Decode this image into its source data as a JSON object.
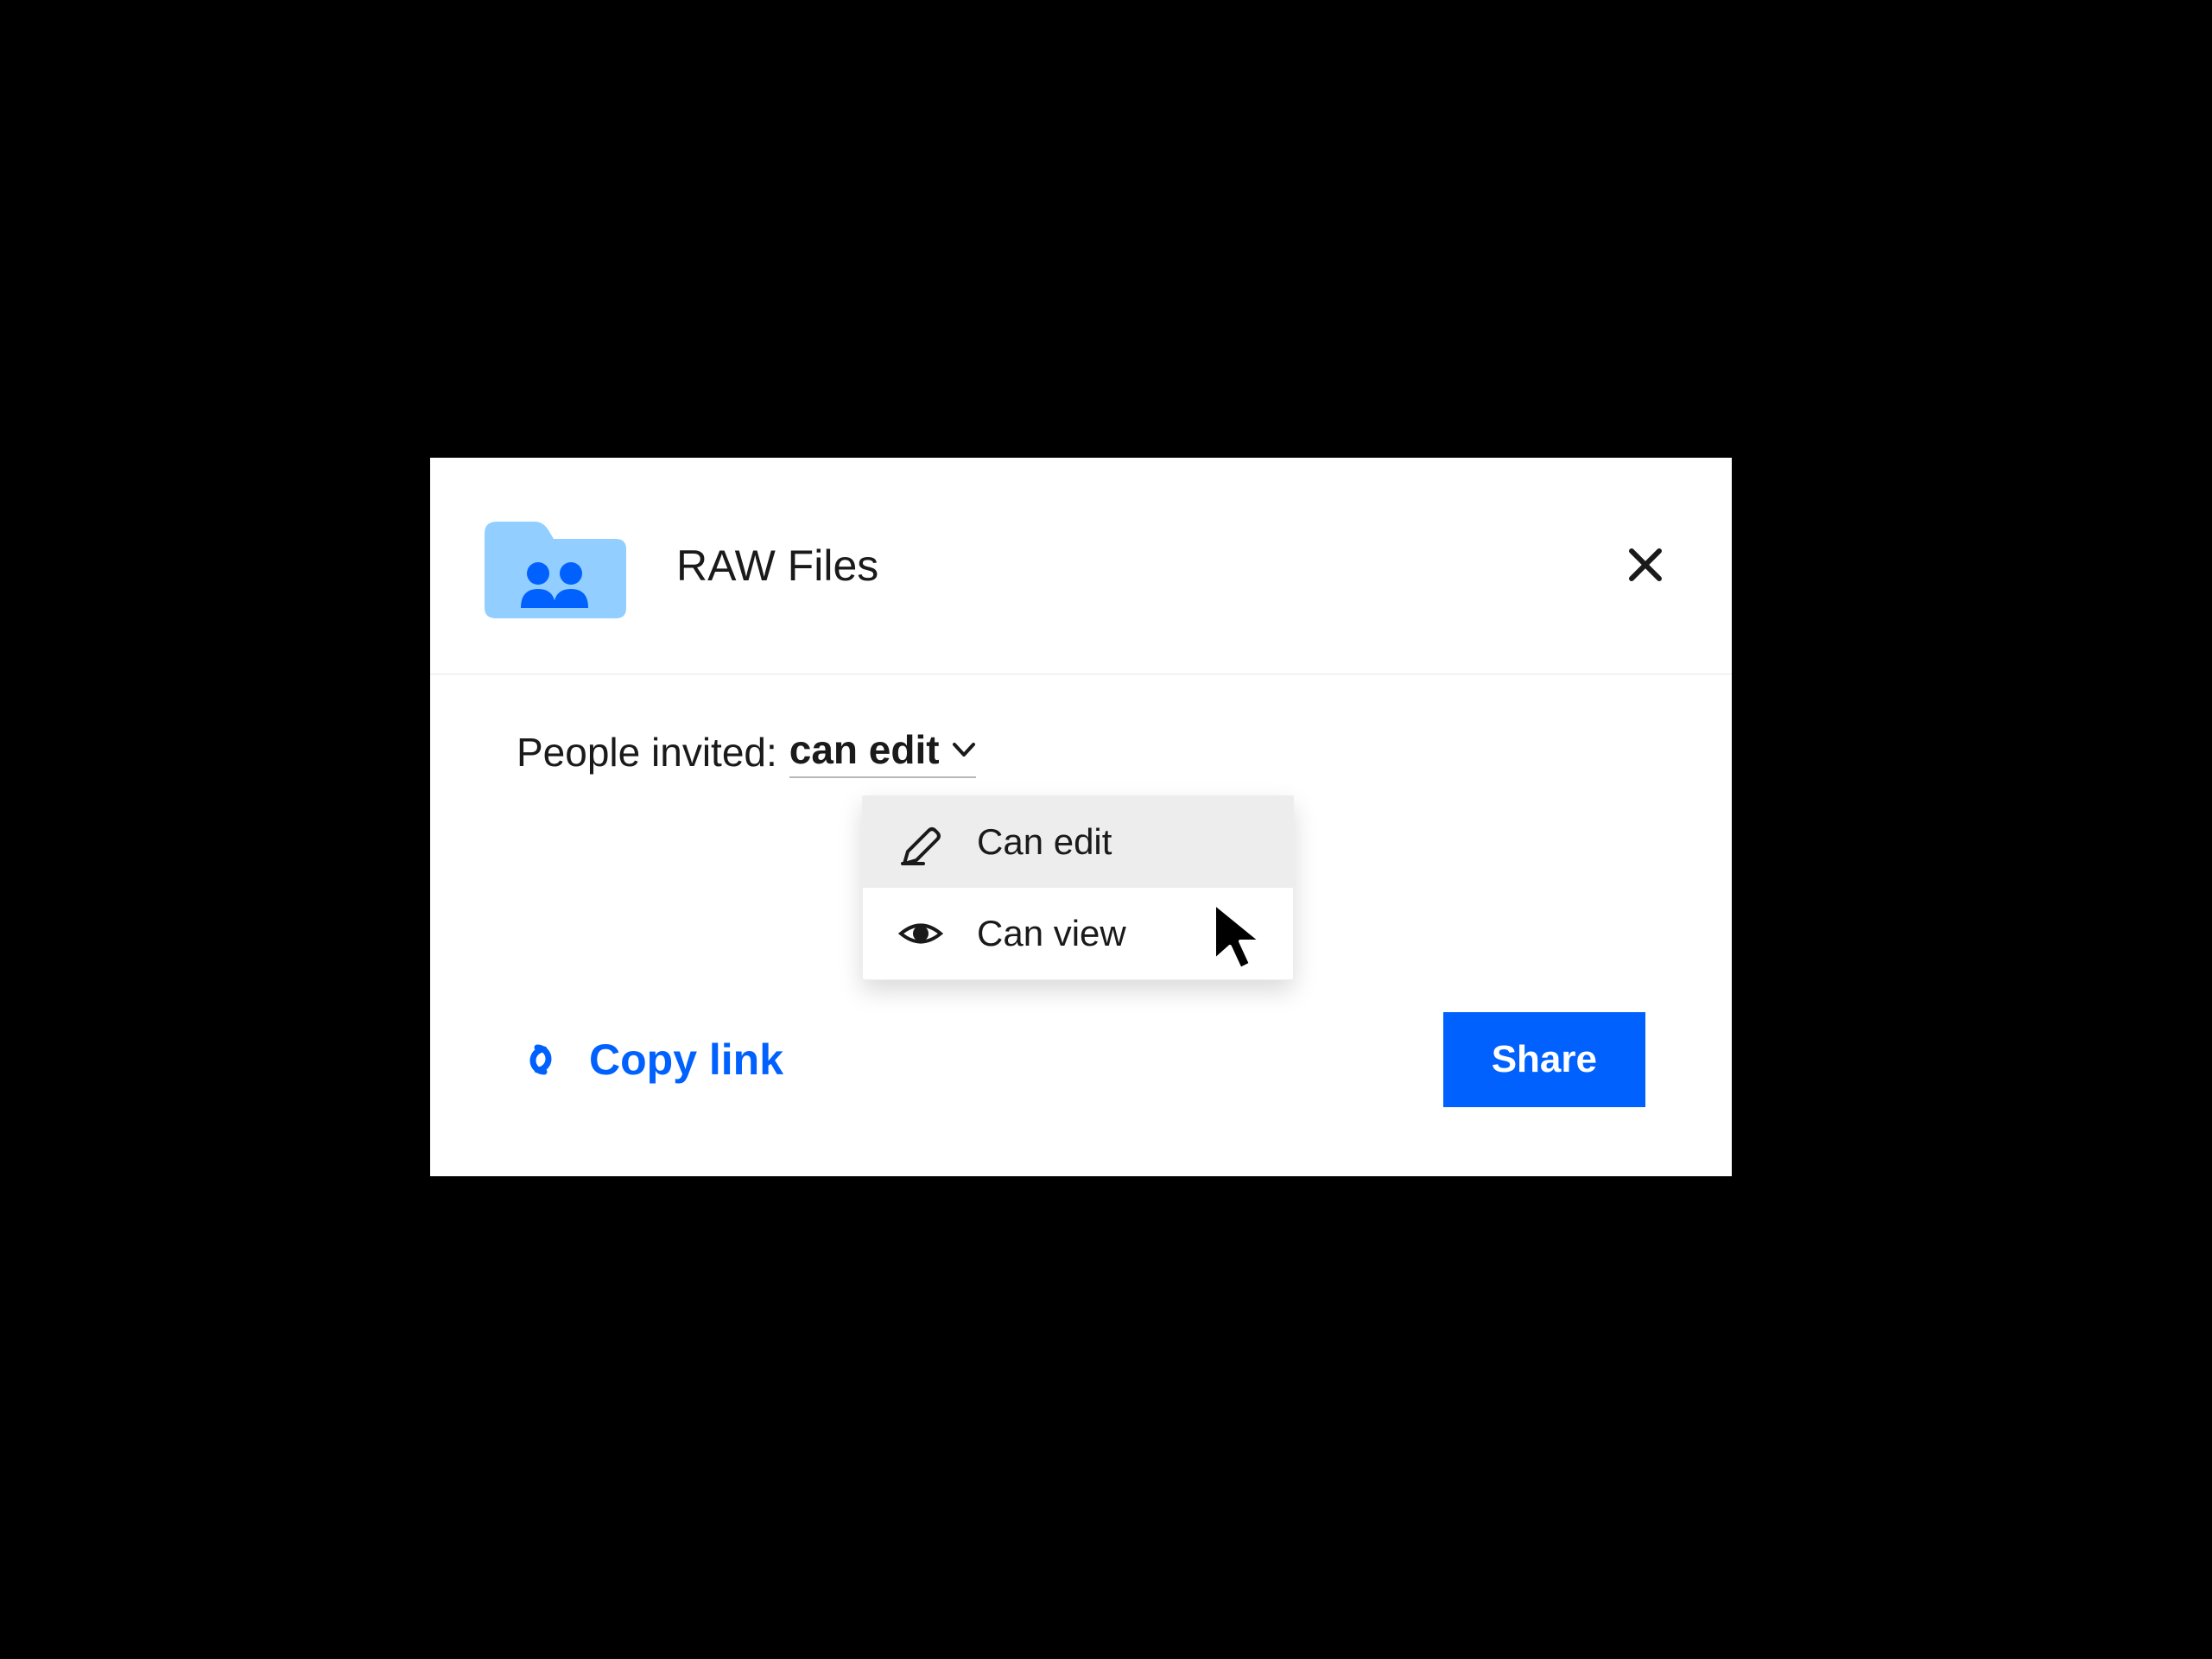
{
  "dialog": {
    "folder_name": "RAW Files",
    "close_aria": "Close"
  },
  "permissions": {
    "label": "People invited:",
    "selected": "can edit",
    "options": [
      {
        "label": "Can edit",
        "highlighted": true
      },
      {
        "label": "Can view",
        "highlighted": false
      }
    ]
  },
  "footer": {
    "copy_link_label": "Copy link",
    "share_label": "Share"
  },
  "colors": {
    "accent": "#0061fe",
    "folder": "#92ceff"
  }
}
